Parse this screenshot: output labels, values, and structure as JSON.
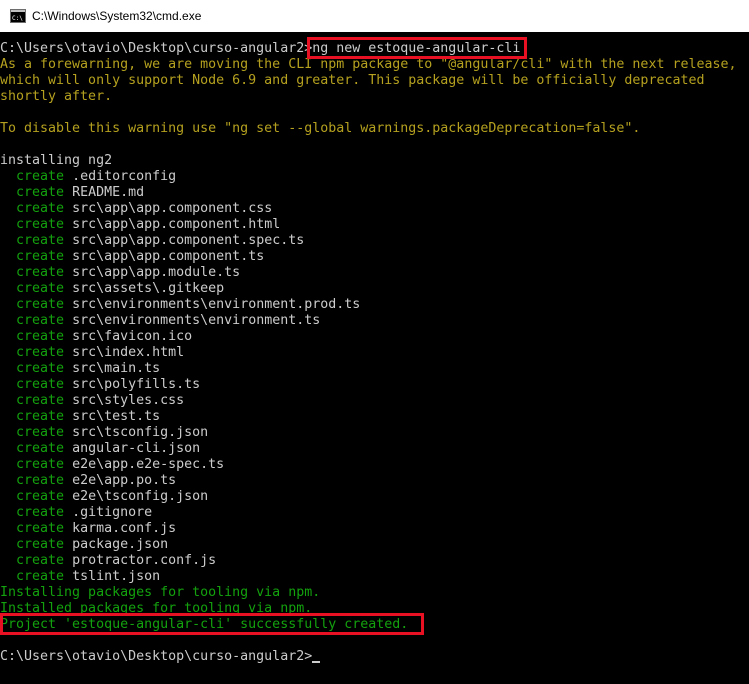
{
  "window": {
    "title": "C:\\Windows\\System32\\cmd.exe",
    "icon": "cmd-icon"
  },
  "console": {
    "colors": {
      "background": "#000000",
      "default": "#cccccc",
      "warning": "#b5a11f",
      "success": "#13a10e",
      "highlight": "#e81123"
    },
    "prompt": "C:\\Users\\otavio\\Desktop\\curso-angular2>",
    "command": "ng new estoque-angular-cli",
    "warning_lines": [
      "As a forewarning, we are moving the CLI npm package to \"@angular/cli\" with the next release,",
      "which will only support Node 6.9 and greater. This package will be officially deprecated",
      "shortly after."
    ],
    "disable_warning": "To disable this warning use \"ng set --global warnings.packageDeprecation=false\".",
    "installing": "installing ng2",
    "create_keyword": "create",
    "created_files": [
      ".editorconfig",
      "README.md",
      "src\\app\\app.component.css",
      "src\\app\\app.component.html",
      "src\\app\\app.component.spec.ts",
      "src\\app\\app.component.ts",
      "src\\app\\app.module.ts",
      "src\\assets\\.gitkeep",
      "src\\environments\\environment.prod.ts",
      "src\\environments\\environment.ts",
      "src\\favicon.ico",
      "src\\index.html",
      "src\\main.ts",
      "src\\polyfills.ts",
      "src\\styles.css",
      "src\\test.ts",
      "src\\tsconfig.json",
      "angular-cli.json",
      "e2e\\app.e2e-spec.ts",
      "e2e\\app.po.ts",
      "e2e\\tsconfig.json",
      ".gitignore",
      "karma.conf.js",
      "package.json",
      "protractor.conf.js",
      "tslint.json"
    ],
    "installing_packages": "Installing packages for tooling via npm.",
    "installed_packages": "Installed packages for tooling via npm.",
    "success_message": "Project 'estoque-angular-cli' successfully created.",
    "final_prompt": "C:\\Users\\otavio\\Desktop\\curso-angular2>"
  }
}
